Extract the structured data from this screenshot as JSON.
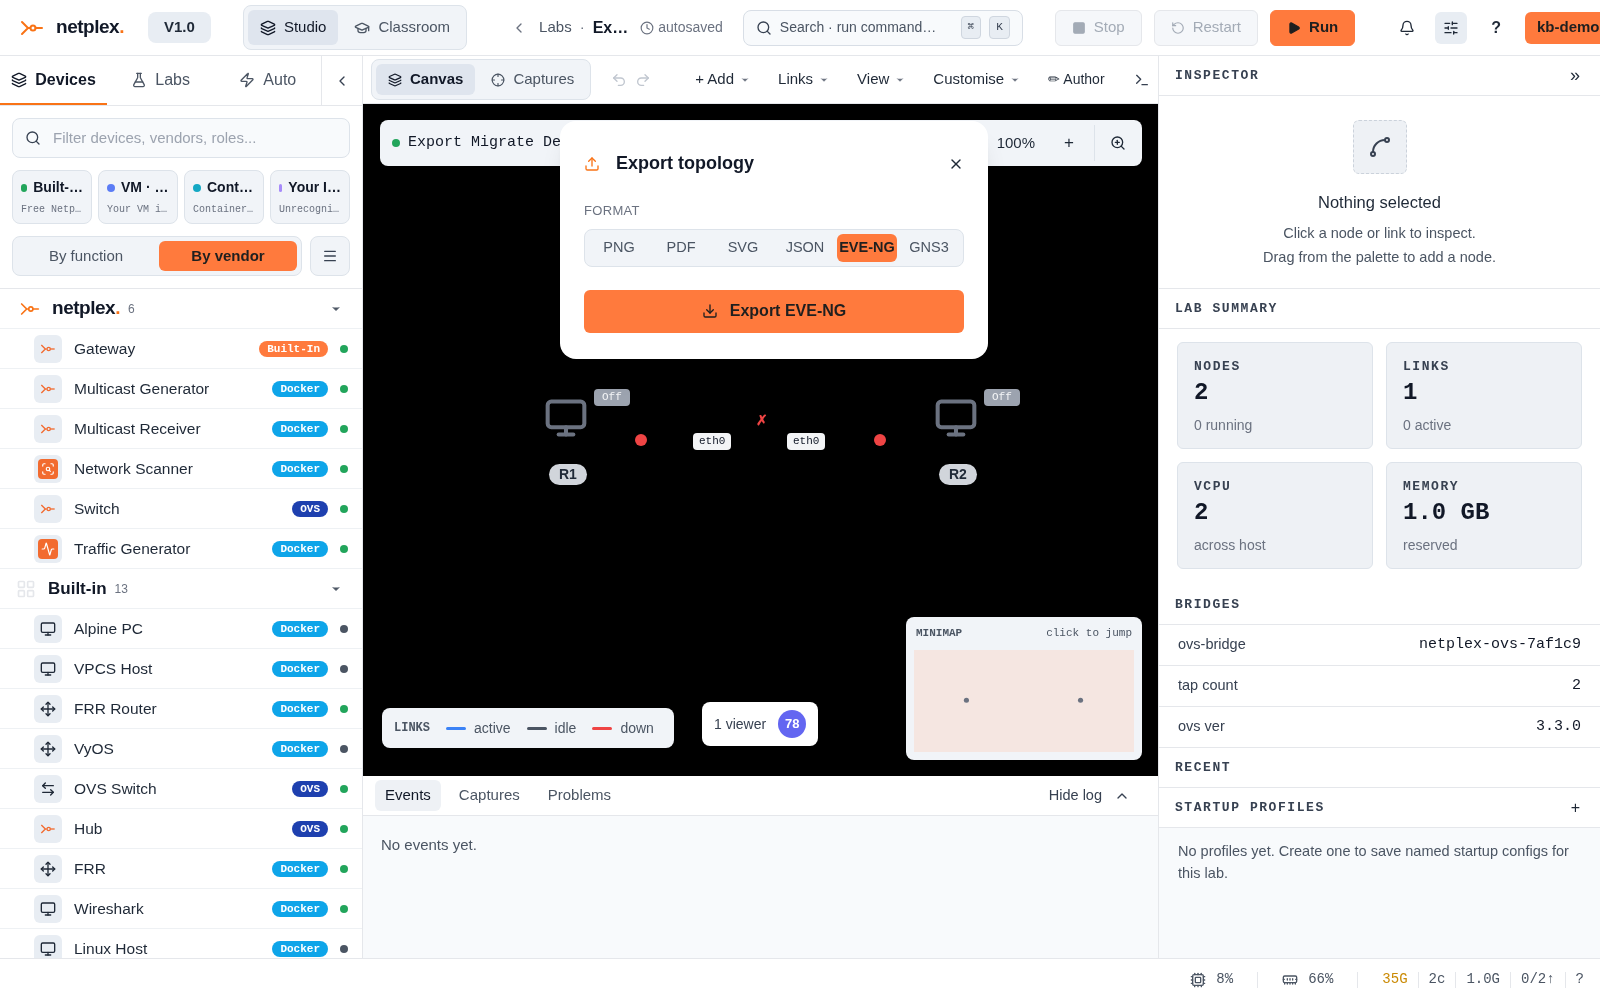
{
  "header": {
    "brand": {
      "name": "netplex",
      "dot": "."
    },
    "version": "V1.0",
    "modes": [
      {
        "label": "Studio",
        "selected": true
      },
      {
        "label": "Classroom",
        "selected": false
      }
    ],
    "breadcrumb": {
      "parent": "Labs",
      "separator": "·",
      "current": "Ex…",
      "save_state": "autosaved"
    },
    "search": {
      "placeholder": "Search · run command…",
      "keys": [
        "⌘",
        "K"
      ]
    },
    "actions": [
      {
        "label": "Stop",
        "kind": "stop",
        "disabled": true
      },
      {
        "label": "Restart",
        "kind": "restart",
        "disabled": true
      },
      {
        "label": "Run",
        "kind": "run",
        "disabled": false
      }
    ],
    "help": "?",
    "user": "kb-demo"
  },
  "sidebar": {
    "tabs": [
      {
        "label": "Devices",
        "selected": true
      },
      {
        "label": "Labs",
        "selected": false
      },
      {
        "label": "Auto",
        "selected": false
      }
    ],
    "filter": {
      "placeholder": "Filter devices, vendors, roles..."
    },
    "sources": [
      {
        "title": "Built-…",
        "subtitle": "Free Netp…",
        "color": "#22a55b"
      },
      {
        "title": "VM · …",
        "subtitle": "Your VM i…",
        "color": "#5b7cf5"
      },
      {
        "title": "Cont…",
        "subtitle": "Container…",
        "color": "#14a8c4"
      },
      {
        "title": "Your I…",
        "subtitle": "Unrecogni…",
        "color": "#a78bfa"
      }
    ],
    "grouping": [
      {
        "label": "By function",
        "selected": false
      },
      {
        "label": "By vendor",
        "selected": true
      }
    ],
    "groups": [
      {
        "kind": "netplex",
        "name": {
          "name": "netplex",
          "dot": "."
        },
        "count": "6",
        "expanded": true,
        "items": [
          {
            "name": "Gateway",
            "kind": "logo",
            "badge": {
              "label": "Built-In",
              "kind": "builtin"
            },
            "running": true
          },
          {
            "name": "Multicast Generator",
            "kind": "logo",
            "badge": {
              "label": "Docker",
              "kind": "docker"
            },
            "running": true
          },
          {
            "name": "Multicast Receiver",
            "kind": "logo",
            "badge": {
              "label": "Docker",
              "kind": "docker"
            },
            "running": true
          },
          {
            "name": "Network Scanner",
            "kind": "scanner",
            "badge": {
              "label": "Docker",
              "kind": "docker"
            },
            "running": true
          },
          {
            "name": "Switch",
            "kind": "logo",
            "badge": {
              "label": "OVS",
              "kind": "ovs"
            },
            "running": true
          },
          {
            "name": "Traffic Generator",
            "kind": "traffic",
            "badge": {
              "label": "Docker",
              "kind": "docker"
            },
            "running": true
          }
        ]
      },
      {
        "kind": "builtin",
        "name": {
          "name": "Built-in"
        },
        "count": "13",
        "expanded": true,
        "items": [
          {
            "name": "Alpine PC",
            "kind": "monitor",
            "badge": {
              "label": "Docker",
              "kind": "docker"
            },
            "running": false
          },
          {
            "name": "VPCS Host",
            "kind": "monitor",
            "badge": {
              "label": "Docker",
              "kind": "docker"
            },
            "running": false
          },
          {
            "name": "FRR Router",
            "kind": "router",
            "badge": {
              "label": "Docker",
              "kind": "docker"
            },
            "running": true
          },
          {
            "name": "VyOS",
            "kind": "router",
            "badge": {
              "label": "Docker",
              "kind": "docker"
            },
            "running": false
          },
          {
            "name": "OVS Switch",
            "kind": "switch",
            "badge": {
              "label": "OVS",
              "kind": "ovs"
            },
            "running": true
          },
          {
            "name": "Hub",
            "kind": "logo",
            "badge": {
              "label": "OVS",
              "kind": "ovs"
            },
            "running": true
          },
          {
            "name": "FRR",
            "kind": "router",
            "badge": {
              "label": "Docker",
              "kind": "docker"
            },
            "running": true
          },
          {
            "name": "Wireshark",
            "kind": "monitor",
            "badge": {
              "label": "Docker",
              "kind": "docker"
            },
            "running": true
          },
          {
            "name": "Linux Host",
            "kind": "monitor",
            "badge": {
              "label": "Docker",
              "kind": "docker"
            },
            "running": false
          }
        ]
      }
    ]
  },
  "toolbar": {
    "views": [
      {
        "label": "Canvas",
        "selected": true
      },
      {
        "label": "Captures",
        "selected": false
      }
    ],
    "menus": [
      "+ Add",
      "Links",
      "View",
      "Customise"
    ],
    "author": "✏ Author"
  },
  "canvas": {
    "lab": {
      "name": "Export Migrate De",
      "running": true
    },
    "zoom": "100%",
    "zoom_in": "+",
    "nodes": [
      {
        "label": "R1",
        "status": "Off"
      },
      {
        "label": "R2",
        "status": "Off"
      }
    ],
    "link": {
      "kind": "down",
      "ports": [
        "eth0",
        "eth0"
      ],
      "mark": "✗"
    },
    "legend": {
      "title": "LINKS",
      "items": [
        {
          "label": "active",
          "color": "#3b82f6"
        },
        {
          "label": "idle",
          "color": "#4b5563"
        },
        {
          "label": "down",
          "color": "#ef4444"
        }
      ]
    },
    "viewers": {
      "label": "1 viewer",
      "count": "78"
    },
    "minimap": {
      "title": "MINIMAP",
      "hint": "click to jump"
    }
  },
  "export_dialog": {
    "title": "Export topology",
    "format_label": "FORMAT",
    "formats": [
      {
        "label": "PNG",
        "selected": false
      },
      {
        "label": "PDF",
        "selected": false
      },
      {
        "label": "SVG",
        "selected": false
      },
      {
        "label": "JSON",
        "selected": false
      },
      {
        "label": "EVE-NG",
        "selected": true
      },
      {
        "label": "GNS3",
        "selected": false
      }
    ],
    "button": "Export EVE-NG"
  },
  "log": {
    "tabs": [
      {
        "label": "Events",
        "selected": true
      },
      {
        "label": "Captures",
        "selected": false
      },
      {
        "label": "Problems",
        "selected": false
      }
    ],
    "toggle": "Hide log",
    "empty": "No events yet."
  },
  "inspector": {
    "title": "INSPECTOR",
    "collapse": "»",
    "empty_title": "Nothing selected",
    "empty_lines": [
      "Click a node or link to inspect.",
      "Drag from the palette to add a node."
    ],
    "summary_title": "LAB SUMMARY",
    "stats": [
      {
        "label": "NODES",
        "value": "2",
        "note": "0 running"
      },
      {
        "label": "LINKS",
        "value": "1",
        "note": "0 active"
      },
      {
        "label": "VCPU",
        "value": "2",
        "note": "across host"
      },
      {
        "label": "MEMORY",
        "value": "1.0 GB",
        "note": "reserved"
      }
    ],
    "bridges_title": "BRIDGES",
    "bridges": [
      {
        "key": "ovs-bridge",
        "value": "netplex-ovs-7af1c9"
      },
      {
        "key": "tap count",
        "value": "2"
      },
      {
        "key": "ovs ver",
        "value": "3.3.0"
      }
    ],
    "recent_title": "RECENT",
    "profiles_title": "STARTUP PROFILES",
    "profiles_add": "+",
    "profiles_empty": "No profiles yet. Create one to save named startup configs for this lab."
  },
  "status_bar": [
    {
      "kind": "cpu",
      "text": "8%"
    },
    {
      "kind": "memory",
      "text": "66%"
    },
    {
      "kind": "warn",
      "text": "35G"
    },
    {
      "kind": "plain",
      "text": "2c"
    },
    {
      "kind": "plain",
      "text": "1.0G"
    },
    {
      "kind": "plain",
      "text": "0/2↑"
    },
    {
      "kind": "plain",
      "text": "?"
    }
  ]
}
